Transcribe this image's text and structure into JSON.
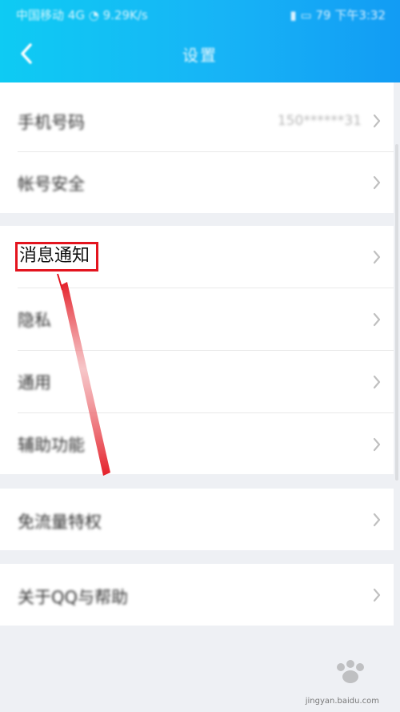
{
  "status_bar": {
    "carrier": "中国移动",
    "network": "4G",
    "speed": "9.29K/s",
    "battery": "79",
    "time": "下午3:32"
  },
  "header": {
    "title": "设置"
  },
  "groups": [
    {
      "items": [
        {
          "label": "手机号码",
          "value": "150******31"
        },
        {
          "label": "帐号安全"
        }
      ]
    },
    {
      "items": [
        {
          "label": "消息通知"
        },
        {
          "label": "隐私"
        },
        {
          "label": "通用"
        },
        {
          "label": "辅助功能"
        }
      ]
    },
    {
      "items": [
        {
          "label": "免流量特权"
        }
      ]
    },
    {
      "items": [
        {
          "label": "关于QQ与帮助"
        }
      ]
    }
  ],
  "annotation": {
    "highlight_label": "消息通知",
    "arrow_color": "#e3141e"
  },
  "watermark": {
    "text": "jingyan.baidu.com"
  },
  "colors": {
    "header_start": "#0ecbf3",
    "header_end": "#129cf4",
    "background": "#eef0f4",
    "highlight": "#e3141e"
  }
}
